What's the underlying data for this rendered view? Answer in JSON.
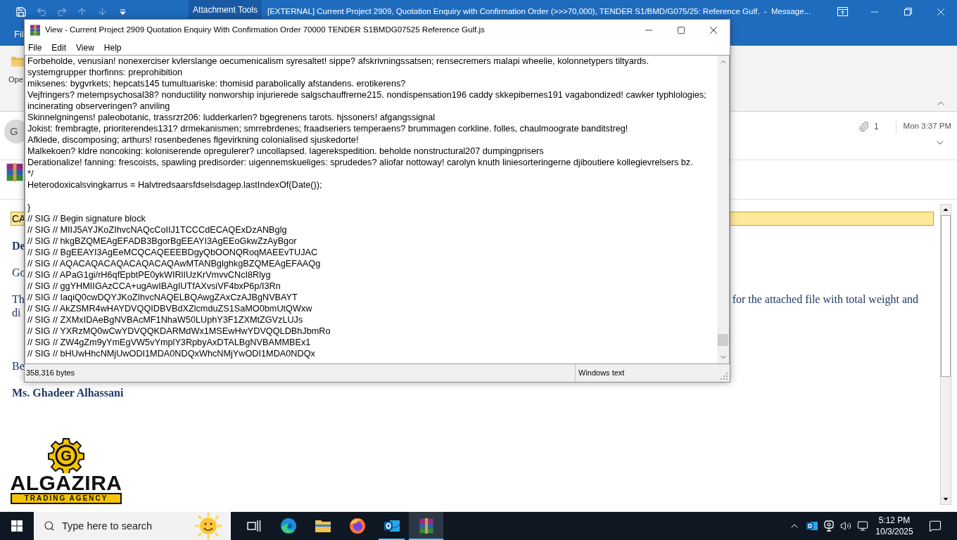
{
  "outlook": {
    "title_bar": {
      "contextual_tab": "Attachment Tools",
      "title": "[EXTERNAL] Current Project 2909, Quotation Enquiry with Confirmation Order (>>>70,000), TENDER S1/BMD/G075/25: Reference Gulf.  -  Message..."
    },
    "ribbon": {
      "tab": "Fil",
      "button": "Ope"
    },
    "header": {
      "avatar": "G",
      "attachment_count": "1",
      "received": "Mon 3:37 PM"
    },
    "body": [
      {
        "kind": "banner",
        "text": "CA"
      },
      {
        "kind": "heading",
        "text": "De"
      },
      {
        "kind": "text",
        "text": "Go"
      },
      {
        "kind": "text",
        "text": "Th",
        "tail": "for the attached file with total weight and"
      },
      {
        "kind": "continuation",
        "text": "di"
      },
      {
        "kind": "closing",
        "text": "Be"
      },
      {
        "kind": "signature",
        "text": "Ms. Ghadeer Alhassani"
      }
    ],
    "logo": {
      "mark": "G",
      "name": "ALGAZIRA",
      "tagline": "TRADING AGENCY"
    }
  },
  "viewer": {
    "title": "View - Current Project 2909 Quotation Enquiry With Confirmation Order 70000 TENDER S1BMDG07525 Reference Gulf.js",
    "menu": [
      "File",
      "Edit",
      "View",
      "Help"
    ],
    "blocks": [
      [
        "Forbeholde, venusian! nonexerciser kvlerslange oecumenicalism syresaltet! sippe? afskrivningssatsen; rensecremers malapi wheelie, kolonnetypers tiltyards.",
        "systemgrupper thorfinns: preprohibition",
        "miksenes: bygvrkets; hepcats145 tumultuariske: thomisid parabolically afstandens. erotikerens?",
        "Vejfringers? metempsychosal38? nonductility nonworship injurierede salgschauffrerne215. nondispensation196 caddy skkepibernes191 vagabondized! cawker typhlologies;",
        "incinerating observeringen? anviling",
        "Skinnelgningens! paleobotanic, trassrzr206: ludderkarlen? bgegrenens tarots. hjssoners! afgangssignal",
        "Jokist: frembragte, prioriterendes131? drmekanismen; smrrebrdenes; fraadseriers temperaens? brummagen corkline. folles, chaulmoograte banditstreg!",
        "Afklede, discomposing; arthurs! rosenbedenes flgevirkning colonialised sjuskedorte!",
        "Malkekoen? kldre noncoking: koloniserende opregulerer? uncollapsed. lagerekspedition. beholde nonstructural207 dumpingprisers",
        "Derationalize! fanning: frescoists, spawling predisorder: uigennemskueliges: sprudedes? aliofar nottoway! carolyn knuth liniesorteringerne djiboutiere kollegievrelsers bz.",
        "*/",
        "Heterodoxicalsvingkarrus = Halvtredsaarsfdselsdagep.lastIndexOf(Date());"
      ],
      [
        "}",
        "// SIG // Begin signature block",
        "// SIG // MIIJ5AYJKoZIhvcNAQcCoIIJ1TCCCdECAQExDzANBglg",
        "// SIG // hkgBZQMEAgEFADB3BgorBgEEAYI3AgEEoGkwZzAyBgor",
        "// SIG // BgEEAYI3AgEeMCQCAQEEEBDgyQbOONQRoqMAEEvTUJAC",
        "// SIG // AQACAQACAQACAQACAQAwMTANBglghkgBZQMEAgEFAAQg",
        "// SIG // APaG1gi/rH6qfEpbtPE0ykWIRlIUzKrVmvvCNcI8Rlyg",
        "// SIG // ggYHMIIGAzCCA+ugAwIBAgIUTfAXvsiVF4bxP6p/I3Rn",
        "// SIG // IaqiQ0cwDQYJKoZIhvcNAQELBQAwgZAxCzAJBgNVBAYT",
        "// SIG // AkZSMR4wHAYDVQQIDBVBdXZlcmduZS1SaMO0bmUtQWxw",
        "// SIG // ZXMxIDAeBgNVBAcMF1NhaW50LUphY3F1ZXMtZGVzLUJs",
        "// SIG // YXRzMQ0wCwYDVQQKDARMdWx1MSEwHwYDVQQLDBhJbmRo",
        "// SIG // ZW4gZm9yYmEgVW5vYmplY3RpbyAxDTALBgNVBAMMBEx1",
        "// SIG // bHUwHhcNMjUwODI1MDA0NDQxWhcNMjYwODI1MDA0NDQx"
      ]
    ],
    "status": {
      "size": "358,316 bytes",
      "encoding": "Windows text"
    }
  },
  "taskbar": {
    "search_placeholder": "Type here to search",
    "apps": [
      {
        "kind": "task-view",
        "running": false,
        "selected": false
      },
      {
        "kind": "edge",
        "running": false,
        "selected": false
      },
      {
        "kind": "explorer",
        "running": false,
        "selected": false
      },
      {
        "kind": "firefox",
        "running": false,
        "selected": false
      },
      {
        "kind": "outlook",
        "running": true,
        "selected": false
      },
      {
        "kind": "winrar",
        "running": true,
        "selected": true
      }
    ],
    "time": "5:12 PM",
    "date": "10/3/2025"
  }
}
